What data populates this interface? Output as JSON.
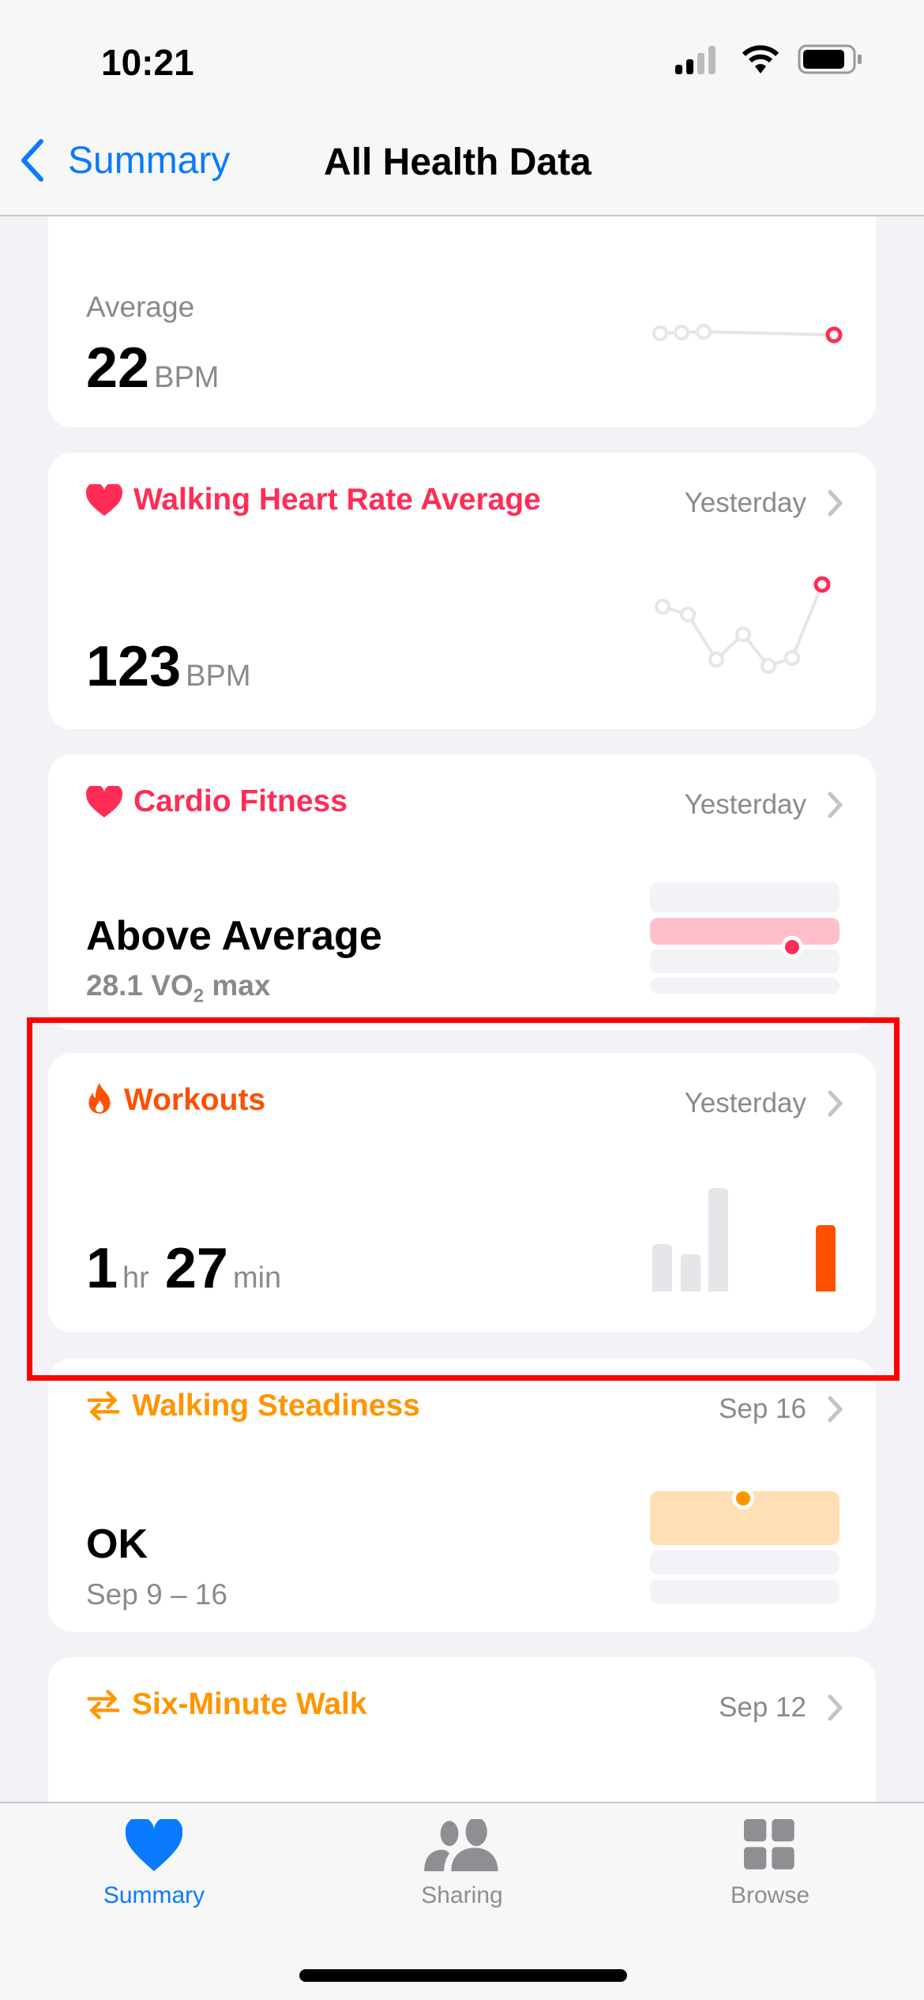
{
  "status": {
    "time": "10:21"
  },
  "nav": {
    "back_label": "Summary",
    "title": "All Health Data"
  },
  "cards": [
    {
      "label": "Average",
      "value": "22",
      "unit": "BPM"
    },
    {
      "title": "Walking Heart Rate Average",
      "date": "Yesterday",
      "value": "123",
      "unit": "BPM",
      "color": "#ff2d55"
    },
    {
      "title": "Cardio Fitness",
      "date": "Yesterday",
      "value": "Above Average",
      "detail_prefix": "28.1 VO",
      "detail_sub": "2",
      "detail_suffix": " max",
      "color": "#ff2d55"
    },
    {
      "title": "Workouts",
      "date": "Yesterday",
      "hours": "1",
      "hours_unit": "hr",
      "minutes": "27",
      "minutes_unit": "min",
      "color": "#ff4f00",
      "highlighted": true
    },
    {
      "title": "Walking Steadiness",
      "date": "Sep 16",
      "value": "OK",
      "detail": "Sep 9 – 16",
      "color": "#ff9500"
    },
    {
      "title": "Six-Minute Walk",
      "date": "Sep 12",
      "color": "#ff9500"
    }
  ],
  "tabs": [
    {
      "label": "Summary",
      "icon": "heart",
      "active": true
    },
    {
      "label": "Sharing",
      "icon": "people"
    },
    {
      "label": "Browse",
      "icon": "grid"
    }
  ],
  "colors": {
    "accent": "#0a7aff",
    "highlight_box": "#ff0000"
  }
}
